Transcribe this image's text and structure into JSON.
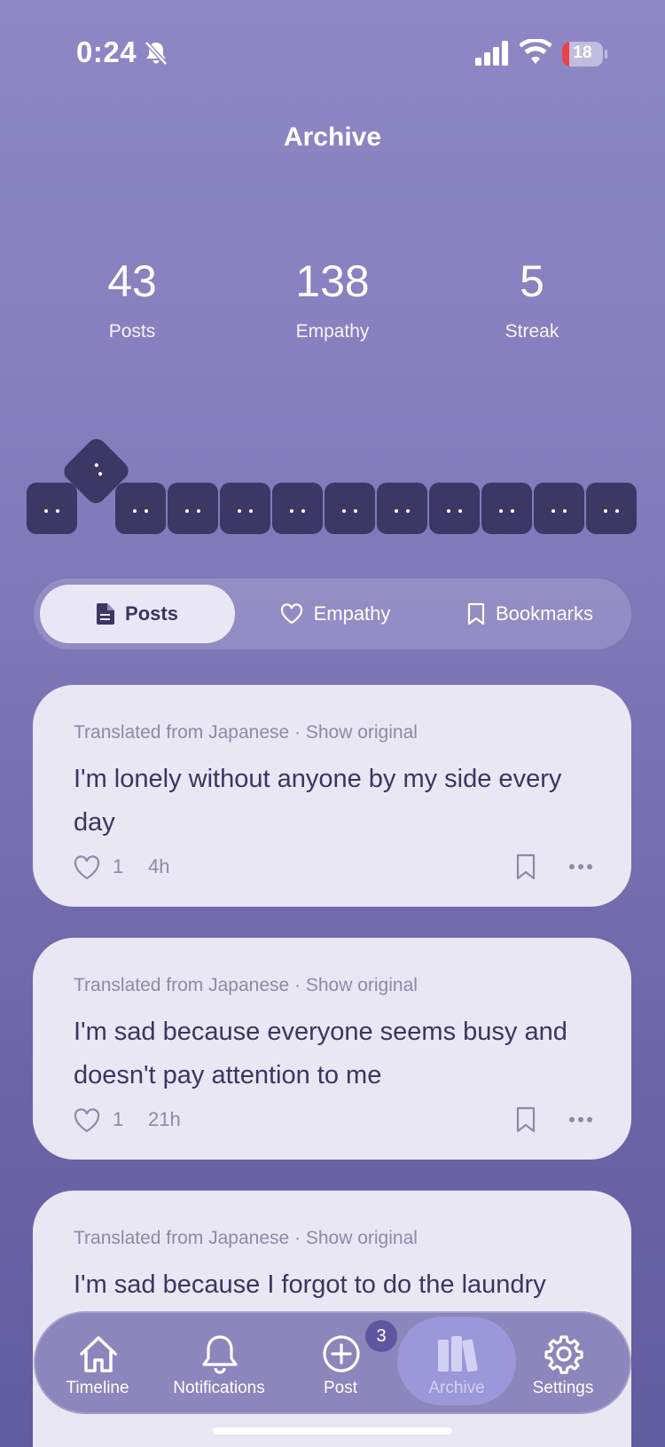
{
  "status_bar": {
    "time": "0:24",
    "battery": "18",
    "icons": [
      "bell-slash-icon",
      "cellular-signal-icon",
      "wifi-icon",
      "battery-icon"
    ]
  },
  "header": {
    "title": "Archive"
  },
  "stats": [
    {
      "value": "43",
      "label": "Posts"
    },
    {
      "value": "138",
      "label": "Empathy"
    },
    {
      "value": "5",
      "label": "Streak"
    }
  ],
  "mood_blocks": {
    "count": 12,
    "color": "#3d3766"
  },
  "tabs": [
    {
      "label": "Posts",
      "icon": "document-icon",
      "active": true
    },
    {
      "label": "Empathy",
      "icon": "heart-outline-icon",
      "active": false
    },
    {
      "label": "Bookmarks",
      "icon": "bookmark-outline-icon",
      "active": false
    }
  ],
  "posts": [
    {
      "meta": "Translated from Japanese · Show original",
      "text": "I'm lonely without anyone by my side every day",
      "likes": "1",
      "age": "4h"
    },
    {
      "meta": "Translated from Japanese · Show original",
      "text": "I'm sad because everyone seems busy and doesn't pay attention to me",
      "likes": "1",
      "age": "21h"
    },
    {
      "meta": "Translated from Japanese · Show original",
      "text": "I'm sad because I forgot to do the laundry",
      "likes": "",
      "age": ""
    }
  ],
  "tabbar": {
    "items": [
      {
        "label": "Timeline",
        "icon": "house-icon"
      },
      {
        "label": "Notifications",
        "icon": "bell-icon"
      },
      {
        "label": "Post",
        "icon": "plus-circle-icon"
      },
      {
        "label": "Archive",
        "icon": "books-icon",
        "active": true
      },
      {
        "label": "Settings",
        "icon": "gear-icon"
      }
    ],
    "post_badge": "3"
  },
  "colors": {
    "background_top": "#8d88c5",
    "background_bottom": "#615b9f",
    "card": "#e9e7f4",
    "text_dark": "#3a3660",
    "meta_text": "#8d8aa6",
    "battery_low": "#e8434a"
  }
}
